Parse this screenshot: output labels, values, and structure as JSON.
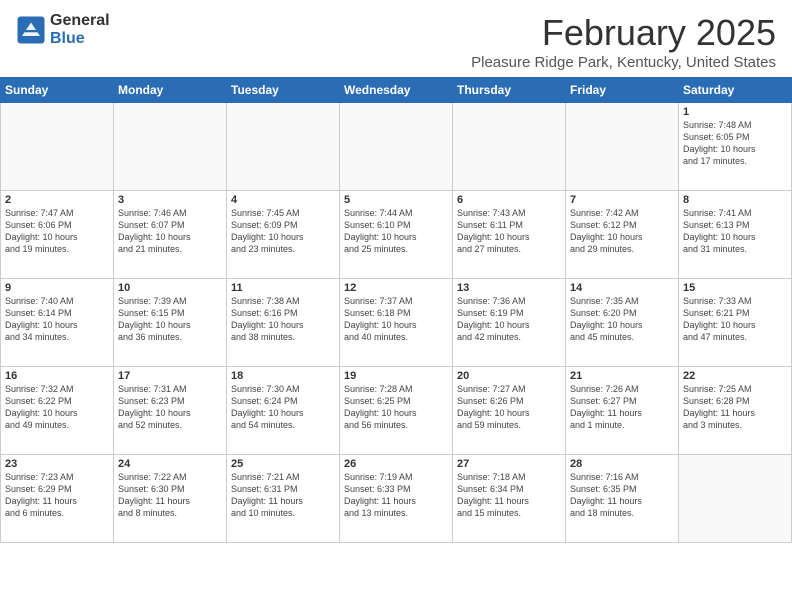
{
  "header": {
    "logo": {
      "general": "General",
      "blue": "Blue"
    },
    "title": "February 2025",
    "location": "Pleasure Ridge Park, Kentucky, United States"
  },
  "days_of_week": [
    "Sunday",
    "Monday",
    "Tuesday",
    "Wednesday",
    "Thursday",
    "Friday",
    "Saturday"
  ],
  "weeks": [
    [
      {
        "day": "",
        "info": ""
      },
      {
        "day": "",
        "info": ""
      },
      {
        "day": "",
        "info": ""
      },
      {
        "day": "",
        "info": ""
      },
      {
        "day": "",
        "info": ""
      },
      {
        "day": "",
        "info": ""
      },
      {
        "day": "1",
        "info": "Sunrise: 7:48 AM\nSunset: 6:05 PM\nDaylight: 10 hours\nand 17 minutes."
      }
    ],
    [
      {
        "day": "2",
        "info": "Sunrise: 7:47 AM\nSunset: 6:06 PM\nDaylight: 10 hours\nand 19 minutes."
      },
      {
        "day": "3",
        "info": "Sunrise: 7:46 AM\nSunset: 6:07 PM\nDaylight: 10 hours\nand 21 minutes."
      },
      {
        "day": "4",
        "info": "Sunrise: 7:45 AM\nSunset: 6:09 PM\nDaylight: 10 hours\nand 23 minutes."
      },
      {
        "day": "5",
        "info": "Sunrise: 7:44 AM\nSunset: 6:10 PM\nDaylight: 10 hours\nand 25 minutes."
      },
      {
        "day": "6",
        "info": "Sunrise: 7:43 AM\nSunset: 6:11 PM\nDaylight: 10 hours\nand 27 minutes."
      },
      {
        "day": "7",
        "info": "Sunrise: 7:42 AM\nSunset: 6:12 PM\nDaylight: 10 hours\nand 29 minutes."
      },
      {
        "day": "8",
        "info": "Sunrise: 7:41 AM\nSunset: 6:13 PM\nDaylight: 10 hours\nand 31 minutes."
      }
    ],
    [
      {
        "day": "9",
        "info": "Sunrise: 7:40 AM\nSunset: 6:14 PM\nDaylight: 10 hours\nand 34 minutes."
      },
      {
        "day": "10",
        "info": "Sunrise: 7:39 AM\nSunset: 6:15 PM\nDaylight: 10 hours\nand 36 minutes."
      },
      {
        "day": "11",
        "info": "Sunrise: 7:38 AM\nSunset: 6:16 PM\nDaylight: 10 hours\nand 38 minutes."
      },
      {
        "day": "12",
        "info": "Sunrise: 7:37 AM\nSunset: 6:18 PM\nDaylight: 10 hours\nand 40 minutes."
      },
      {
        "day": "13",
        "info": "Sunrise: 7:36 AM\nSunset: 6:19 PM\nDaylight: 10 hours\nand 42 minutes."
      },
      {
        "day": "14",
        "info": "Sunrise: 7:35 AM\nSunset: 6:20 PM\nDaylight: 10 hours\nand 45 minutes."
      },
      {
        "day": "15",
        "info": "Sunrise: 7:33 AM\nSunset: 6:21 PM\nDaylight: 10 hours\nand 47 minutes."
      }
    ],
    [
      {
        "day": "16",
        "info": "Sunrise: 7:32 AM\nSunset: 6:22 PM\nDaylight: 10 hours\nand 49 minutes."
      },
      {
        "day": "17",
        "info": "Sunrise: 7:31 AM\nSunset: 6:23 PM\nDaylight: 10 hours\nand 52 minutes."
      },
      {
        "day": "18",
        "info": "Sunrise: 7:30 AM\nSunset: 6:24 PM\nDaylight: 10 hours\nand 54 minutes."
      },
      {
        "day": "19",
        "info": "Sunrise: 7:28 AM\nSunset: 6:25 PM\nDaylight: 10 hours\nand 56 minutes."
      },
      {
        "day": "20",
        "info": "Sunrise: 7:27 AM\nSunset: 6:26 PM\nDaylight: 10 hours\nand 59 minutes."
      },
      {
        "day": "21",
        "info": "Sunrise: 7:26 AM\nSunset: 6:27 PM\nDaylight: 11 hours\nand 1 minute."
      },
      {
        "day": "22",
        "info": "Sunrise: 7:25 AM\nSunset: 6:28 PM\nDaylight: 11 hours\nand 3 minutes."
      }
    ],
    [
      {
        "day": "23",
        "info": "Sunrise: 7:23 AM\nSunset: 6:29 PM\nDaylight: 11 hours\nand 6 minutes."
      },
      {
        "day": "24",
        "info": "Sunrise: 7:22 AM\nSunset: 6:30 PM\nDaylight: 11 hours\nand 8 minutes."
      },
      {
        "day": "25",
        "info": "Sunrise: 7:21 AM\nSunset: 6:31 PM\nDaylight: 11 hours\nand 10 minutes."
      },
      {
        "day": "26",
        "info": "Sunrise: 7:19 AM\nSunset: 6:33 PM\nDaylight: 11 hours\nand 13 minutes."
      },
      {
        "day": "27",
        "info": "Sunrise: 7:18 AM\nSunset: 6:34 PM\nDaylight: 11 hours\nand 15 minutes."
      },
      {
        "day": "28",
        "info": "Sunrise: 7:16 AM\nSunset: 6:35 PM\nDaylight: 11 hours\nand 18 minutes."
      },
      {
        "day": "",
        "info": ""
      }
    ]
  ]
}
